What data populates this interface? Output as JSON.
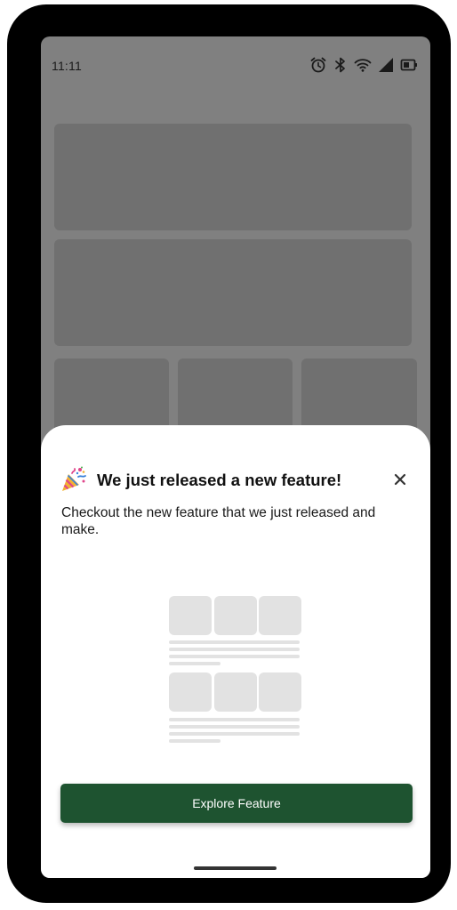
{
  "status_bar": {
    "time": "11:11",
    "icons": [
      "alarm-icon",
      "bluetooth-icon",
      "wifi-icon",
      "signal-icon",
      "battery-icon"
    ]
  },
  "sheet": {
    "icon": "party-popper-icon",
    "title": "We just released a new feature!",
    "description": "Checkout the new feature that we just released and make.",
    "close_icon": "close-icon",
    "primary_button_label": "Explore Feature"
  },
  "colors": {
    "primary": "#1e5330",
    "overlay": "#808080",
    "placeholder": "#e2e2e2"
  }
}
